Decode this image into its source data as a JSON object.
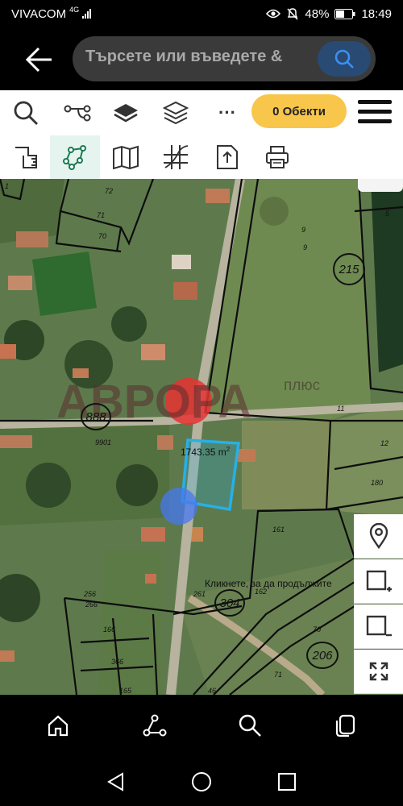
{
  "status_bar": {
    "carrier": "VIVACOM",
    "network": "4G",
    "battery": "48%",
    "time": "18:49"
  },
  "browser": {
    "search_placeholder": "Търсете или въведете &"
  },
  "toolbar": {
    "objects_label": "0 Обекти",
    "more_label": "···"
  },
  "map": {
    "area_value": "1743.35 m",
    "area_unit_sup": "2",
    "click_hint": "Кликнете, за да продължите",
    "watermark": "АВРОРА",
    "watermark_sub": "плюс",
    "circled_numbers": [
      "888",
      "215",
      "304",
      "206"
    ],
    "plot_numbers": [
      "72",
      "71",
      "70",
      "9",
      "9",
      "5",
      "9901",
      "11",
      "12",
      "180",
      "161",
      "162",
      "261",
      "256",
      "266",
      "166",
      "366",
      "165",
      "70",
      "71",
      "46",
      "1"
    ]
  },
  "icons": {
    "back": "arrow-left-icon",
    "search": "search-icon",
    "route": "route-icon",
    "layers": "layers-icon",
    "layers_outline": "layers-outline-icon",
    "measure": "ruler-icon",
    "draw": "polyline-draw-icon",
    "map": "map-icon",
    "grid": "coordinate-grid-icon",
    "export": "export-icon",
    "print": "printer-icon",
    "location": "location-pin-icon",
    "add_rect": "add-rectangle-icon",
    "remove_rect": "remove-rectangle-icon",
    "fullscreen": "fullscreen-icon",
    "home": "home-icon",
    "share": "share-icon",
    "tabs": "tabs-icon"
  },
  "colors": {
    "accent_yellow": "#f7c64a",
    "search_blue": "#284a73",
    "selection_cyan": "#27b0e8",
    "tool_active_bg": "#e5f4ee"
  }
}
